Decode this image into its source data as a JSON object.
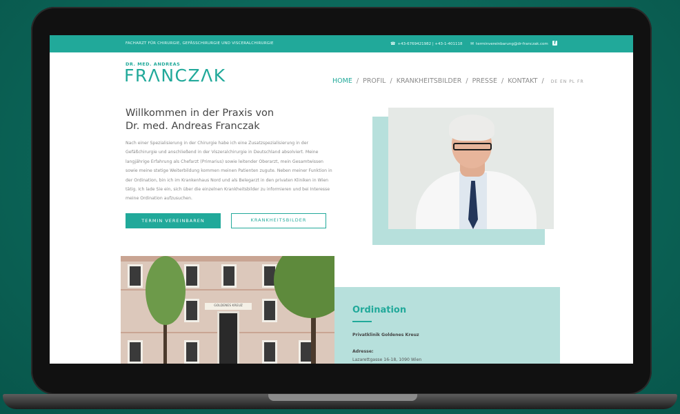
{
  "topbar": {
    "tagline": "FACHARZT FÜR CHIRURGIE, GEFÄSSCHIRURGIE UND VISCERALCHIRURGIE",
    "phone": "+43-6769421982 | +43-1-401118",
    "email": "terminvereinbarung@dr-franczak.com",
    "facebook": "f"
  },
  "logo": {
    "small": "DR. MED. ANDREAS",
    "big": "FRΛNCZΛK"
  },
  "nav": {
    "home": "HOME",
    "profil": "PROFIL",
    "krankheitsbilder": "KRANKHEITSBILDER",
    "presse": "PRESSE",
    "kontakt": "KONTAKT",
    "sep": "/",
    "languages": "DE EN PL FR"
  },
  "hero": {
    "title_line1": "Willkommen in der Praxis von",
    "title_line2": "Dr. med. Andreas Franczak",
    "paragraph": "Nach einer Spezialisierung in der Chirurgie habe ich eine Zusatzspezialisierung in der Gefäßchirurgie und anschließend in der Viszeralchirurgie in Deutschland absolviert. Meine langjährige Erfahrung als Chefarzt (Primarius) sowie leitender Oberarzt, mein Gesamtwissen sowie meine stetige Weiterbildung kommen meinen Patienten zugute. Neben meiner Funktion in der Ordination, bin ich im Krankenhaus Nord und als Belegarzt in den privaten Kliniken in Wien tätig. Ich lade Sie ein, sich über die einzelnen Krankheitsbilder zu informieren und bei Interesse meine Ordination aufzusuchen.",
    "btn_termin": "TERMIN VEREINBAREN",
    "btn_krankheitsbilder": "KRANKHEITSBILDER"
  },
  "building": {
    "sign": "GOLDENES KREUZ"
  },
  "ordination": {
    "title": "Ordination",
    "clinic": "Privatklinik Goldenes Kreuz",
    "address_label": "Adresse:",
    "address": "Lazarettgasse 16-18, 1090 Wien"
  },
  "colors": {
    "accent": "#21a99a",
    "accent_light": "#b7e0dc",
    "background": "#0d6e61"
  }
}
